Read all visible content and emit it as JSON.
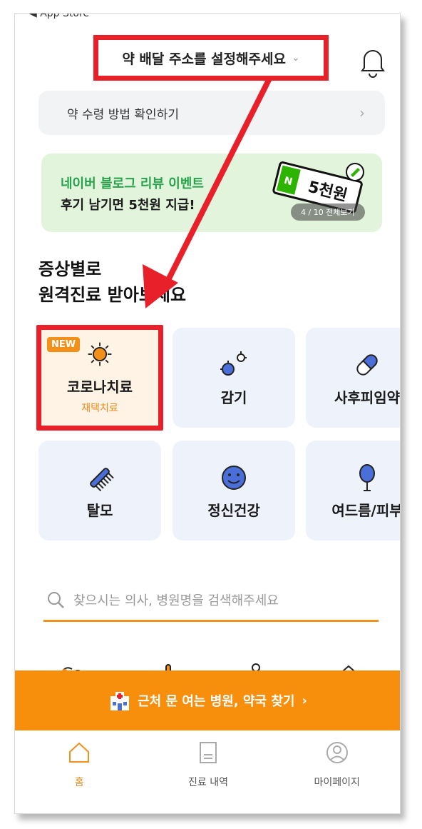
{
  "status_bar": {
    "back_app": "◀ App Store"
  },
  "header": {
    "address_prompt": "약 배달 주소를 설정해주세요",
    "chevron": "⌄",
    "bell_icon": "bell-icon"
  },
  "pickup": {
    "label": "약 수령 방법 확인하기",
    "chevron": "›"
  },
  "banner": {
    "line1": "네이버 블로그 리뷰 이벤트",
    "line2": "후기 남기면 5천원 지급!",
    "art_text": "5천원",
    "art_badge": "N",
    "pager": "4 / 10  전체보기"
  },
  "section": {
    "title_line1": "증상별로",
    "title_line2": "원격진료 받아보세요"
  },
  "categories": [
    {
      "label": "코로나치료",
      "sub": "재택치료",
      "badge": "NEW",
      "icon": "virus-icon"
    },
    {
      "label": "감기",
      "icon": "germ-icon"
    },
    {
      "label": "사후피임약",
      "icon": "pill-icon"
    },
    {
      "label": "탈모",
      "icon": "comb-icon"
    },
    {
      "label": "정신건강",
      "icon": "smile-icon"
    },
    {
      "label": "여드름/피부",
      "icon": "balloon-icon"
    }
  ],
  "search": {
    "placeholder": "찾으시는 의사, 병원명을 검색해주세요"
  },
  "cta": {
    "label": "근처 문 여는 병원, 약국 찾기",
    "chevron": "›"
  },
  "tabs": [
    {
      "label": "홈",
      "icon": "home-icon",
      "active": true
    },
    {
      "label": "진료 내역",
      "icon": "document-icon",
      "active": false
    },
    {
      "label": "마이페이지",
      "icon": "profile-icon",
      "active": false
    }
  ],
  "colors": {
    "accent": "#f78f0c",
    "annotation_red": "#e8202a",
    "banner_green": "#27a14a"
  }
}
